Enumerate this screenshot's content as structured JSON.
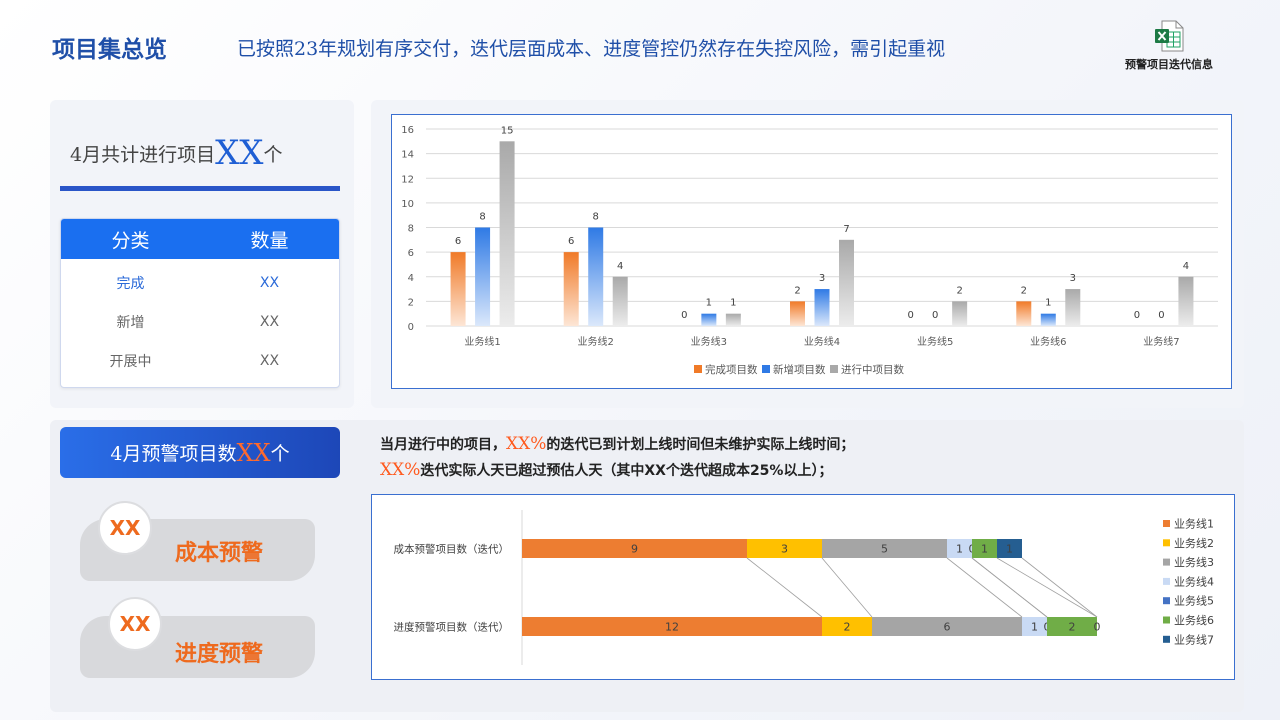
{
  "header": {
    "title": "项目集总览",
    "subtitle": "已按照23年规划有序交付，迭代层面成本、进度管控仍然存在失控风险，需引起重视",
    "excel_caption": "预警项目迭代信息",
    "excel_icon": "excel-file-icon"
  },
  "summary": {
    "title_prefix": "4月共计进行项目",
    "title_value": "XX",
    "title_suffix": "个",
    "table": {
      "headers": [
        "分类",
        "数量"
      ],
      "rows": [
        {
          "category": "完成",
          "count": "XX"
        },
        {
          "category": "新增",
          "count": "XX"
        },
        {
          "category": "开展中",
          "count": "XX"
        }
      ]
    }
  },
  "warning": {
    "banner_prefix": "4月预警项目数",
    "banner_value": "XX",
    "banner_suffix": "个",
    "cost": {
      "value": "XX",
      "label": "成本预警"
    },
    "schedule": {
      "value": "XX",
      "label": "进度预警"
    },
    "desc1_prefix": "当月进行中的项目，",
    "desc1_value": "XX%",
    "desc1_suffix": "的迭代已到计划上线时间但未维护实际上线时间；",
    "desc2_value": "XX%",
    "desc2_suffix": "迭代实际人天已超过预估人天（其中XX个迭代超成本25%以上）；"
  },
  "colors": {
    "done": "#f07a28",
    "new": "#2f7ae5",
    "ongoing": "#a9a9a9",
    "lines": [
      "#ed7d31",
      "#ffc000",
      "#a5a5a5",
      "#c9daf4",
      "#4472c4",
      "#70ad47",
      "#255e91"
    ]
  },
  "chart_data": [
    {
      "type": "bar",
      "categories": [
        "业务线1",
        "业务线2",
        "业务线3",
        "业务线4",
        "业务线5",
        "业务线6",
        "业务线7"
      ],
      "series": [
        {
          "name": "完成项目数",
          "values": [
            6,
            6,
            0,
            2,
            0,
            2,
            0
          ]
        },
        {
          "name": "新增项目数",
          "values": [
            8,
            8,
            1,
            3,
            0,
            1,
            0
          ]
        },
        {
          "name": "进行中项目数",
          "values": [
            15,
            4,
            1,
            7,
            2,
            3,
            4
          ]
        }
      ],
      "ylim": [
        0,
        16
      ],
      "yticks": [
        0,
        2,
        4,
        6,
        8,
        10,
        12,
        14,
        16
      ],
      "grid": true,
      "legend": "bottom"
    },
    {
      "type": "bar",
      "orientation": "horizontal-stacked",
      "categories": [
        "成本预警项目数（迭代）",
        "进度预警项目数（迭代）"
      ],
      "series": [
        {
          "name": "业务线1",
          "values": [
            9,
            12
          ]
        },
        {
          "name": "业务线2",
          "values": [
            3,
            2
          ]
        },
        {
          "name": "业务线3",
          "values": [
            5,
            6
          ]
        },
        {
          "name": "业务线4",
          "values": [
            1,
            1
          ]
        },
        {
          "name": "业务线5",
          "values": [
            0,
            0
          ]
        },
        {
          "name": "业务线6",
          "values": [
            1,
            2
          ]
        },
        {
          "name": "业务线7",
          "values": [
            1,
            0
          ]
        }
      ],
      "series_lines": true,
      "legend": "right"
    }
  ]
}
